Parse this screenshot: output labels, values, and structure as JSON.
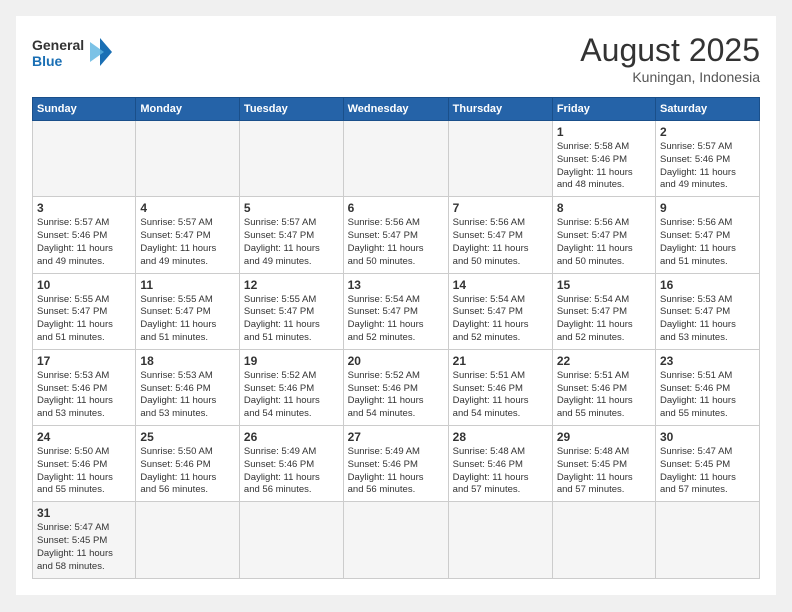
{
  "header": {
    "logo_general": "General",
    "logo_blue": "Blue",
    "month_title": "August 2025",
    "subtitle": "Kuningan, Indonesia"
  },
  "days_of_week": [
    "Sunday",
    "Monday",
    "Tuesday",
    "Wednesday",
    "Thursday",
    "Friday",
    "Saturday"
  ],
  "weeks": [
    [
      {
        "day": "",
        "info": ""
      },
      {
        "day": "",
        "info": ""
      },
      {
        "day": "",
        "info": ""
      },
      {
        "day": "",
        "info": ""
      },
      {
        "day": "",
        "info": ""
      },
      {
        "day": "1",
        "info": "Sunrise: 5:58 AM\nSunset: 5:46 PM\nDaylight: 11 hours\nand 48 minutes."
      },
      {
        "day": "2",
        "info": "Sunrise: 5:57 AM\nSunset: 5:46 PM\nDaylight: 11 hours\nand 49 minutes."
      }
    ],
    [
      {
        "day": "3",
        "info": "Sunrise: 5:57 AM\nSunset: 5:46 PM\nDaylight: 11 hours\nand 49 minutes."
      },
      {
        "day": "4",
        "info": "Sunrise: 5:57 AM\nSunset: 5:47 PM\nDaylight: 11 hours\nand 49 minutes."
      },
      {
        "day": "5",
        "info": "Sunrise: 5:57 AM\nSunset: 5:47 PM\nDaylight: 11 hours\nand 49 minutes."
      },
      {
        "day": "6",
        "info": "Sunrise: 5:56 AM\nSunset: 5:47 PM\nDaylight: 11 hours\nand 50 minutes."
      },
      {
        "day": "7",
        "info": "Sunrise: 5:56 AM\nSunset: 5:47 PM\nDaylight: 11 hours\nand 50 minutes."
      },
      {
        "day": "8",
        "info": "Sunrise: 5:56 AM\nSunset: 5:47 PM\nDaylight: 11 hours\nand 50 minutes."
      },
      {
        "day": "9",
        "info": "Sunrise: 5:56 AM\nSunset: 5:47 PM\nDaylight: 11 hours\nand 51 minutes."
      }
    ],
    [
      {
        "day": "10",
        "info": "Sunrise: 5:55 AM\nSunset: 5:47 PM\nDaylight: 11 hours\nand 51 minutes."
      },
      {
        "day": "11",
        "info": "Sunrise: 5:55 AM\nSunset: 5:47 PM\nDaylight: 11 hours\nand 51 minutes."
      },
      {
        "day": "12",
        "info": "Sunrise: 5:55 AM\nSunset: 5:47 PM\nDaylight: 11 hours\nand 51 minutes."
      },
      {
        "day": "13",
        "info": "Sunrise: 5:54 AM\nSunset: 5:47 PM\nDaylight: 11 hours\nand 52 minutes."
      },
      {
        "day": "14",
        "info": "Sunrise: 5:54 AM\nSunset: 5:47 PM\nDaylight: 11 hours\nand 52 minutes."
      },
      {
        "day": "15",
        "info": "Sunrise: 5:54 AM\nSunset: 5:47 PM\nDaylight: 11 hours\nand 52 minutes."
      },
      {
        "day": "16",
        "info": "Sunrise: 5:53 AM\nSunset: 5:47 PM\nDaylight: 11 hours\nand 53 minutes."
      }
    ],
    [
      {
        "day": "17",
        "info": "Sunrise: 5:53 AM\nSunset: 5:46 PM\nDaylight: 11 hours\nand 53 minutes."
      },
      {
        "day": "18",
        "info": "Sunrise: 5:53 AM\nSunset: 5:46 PM\nDaylight: 11 hours\nand 53 minutes."
      },
      {
        "day": "19",
        "info": "Sunrise: 5:52 AM\nSunset: 5:46 PM\nDaylight: 11 hours\nand 54 minutes."
      },
      {
        "day": "20",
        "info": "Sunrise: 5:52 AM\nSunset: 5:46 PM\nDaylight: 11 hours\nand 54 minutes."
      },
      {
        "day": "21",
        "info": "Sunrise: 5:51 AM\nSunset: 5:46 PM\nDaylight: 11 hours\nand 54 minutes."
      },
      {
        "day": "22",
        "info": "Sunrise: 5:51 AM\nSunset: 5:46 PM\nDaylight: 11 hours\nand 55 minutes."
      },
      {
        "day": "23",
        "info": "Sunrise: 5:51 AM\nSunset: 5:46 PM\nDaylight: 11 hours\nand 55 minutes."
      }
    ],
    [
      {
        "day": "24",
        "info": "Sunrise: 5:50 AM\nSunset: 5:46 PM\nDaylight: 11 hours\nand 55 minutes."
      },
      {
        "day": "25",
        "info": "Sunrise: 5:50 AM\nSunset: 5:46 PM\nDaylight: 11 hours\nand 56 minutes."
      },
      {
        "day": "26",
        "info": "Sunrise: 5:49 AM\nSunset: 5:46 PM\nDaylight: 11 hours\nand 56 minutes."
      },
      {
        "day": "27",
        "info": "Sunrise: 5:49 AM\nSunset: 5:46 PM\nDaylight: 11 hours\nand 56 minutes."
      },
      {
        "day": "28",
        "info": "Sunrise: 5:48 AM\nSunset: 5:46 PM\nDaylight: 11 hours\nand 57 minutes."
      },
      {
        "day": "29",
        "info": "Sunrise: 5:48 AM\nSunset: 5:45 PM\nDaylight: 11 hours\nand 57 minutes."
      },
      {
        "day": "30",
        "info": "Sunrise: 5:47 AM\nSunset: 5:45 PM\nDaylight: 11 hours\nand 57 minutes."
      }
    ],
    [
      {
        "day": "31",
        "info": "Sunrise: 5:47 AM\nSunset: 5:45 PM\nDaylight: 11 hours\nand 58 minutes."
      },
      {
        "day": "",
        "info": ""
      },
      {
        "day": "",
        "info": ""
      },
      {
        "day": "",
        "info": ""
      },
      {
        "day": "",
        "info": ""
      },
      {
        "day": "",
        "info": ""
      },
      {
        "day": "",
        "info": ""
      }
    ]
  ]
}
